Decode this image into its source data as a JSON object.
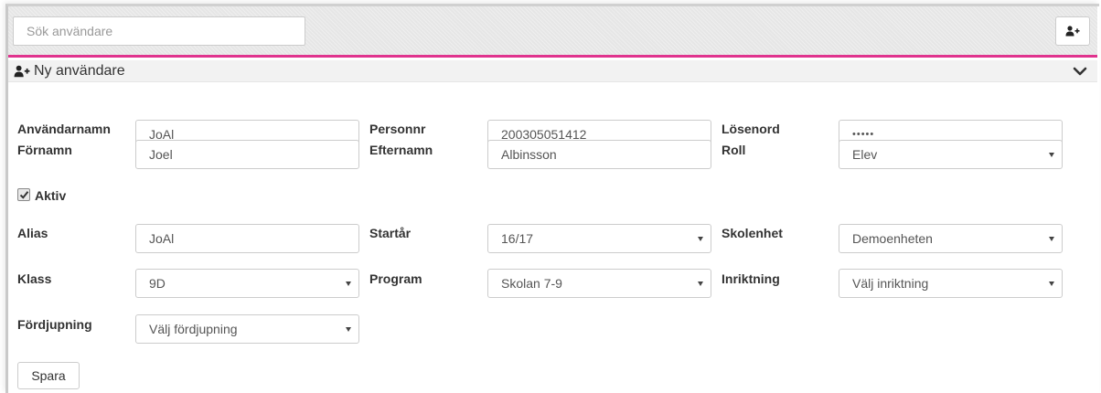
{
  "search": {
    "placeholder": "Sök användare"
  },
  "panel": {
    "title": "Ny användare"
  },
  "fields": {
    "username": {
      "label": "Användarnamn",
      "value": "JoAl"
    },
    "personnr": {
      "label": "Personnr",
      "value": "200305051412"
    },
    "password": {
      "label": "Lösenord",
      "value": "•••••"
    },
    "firstname": {
      "label": "Förnamn",
      "value": "Joel"
    },
    "lastname": {
      "label": "Efternamn",
      "value": "Albinsson"
    },
    "role": {
      "label": "Roll",
      "value": "Elev"
    },
    "active": {
      "label": "Aktiv",
      "checked": true
    },
    "alias": {
      "label": "Alias",
      "value": "JoAl"
    },
    "startyear": {
      "label": "Startår",
      "value": "16/17"
    },
    "schoolunit": {
      "label": "Skolenhet",
      "value": "Demoenheten"
    },
    "class": {
      "label": "Klass",
      "value": "9D"
    },
    "program": {
      "label": "Program",
      "value": "Skolan 7-9"
    },
    "orientation": {
      "label": "Inriktning",
      "value": "Välj inriktning"
    },
    "specialization": {
      "label": "Fördjupning",
      "value": "Välj fördjupning"
    }
  },
  "actions": {
    "save_label": "Spara"
  },
  "colors": {
    "accent": "#e0338e"
  },
  "icons": {
    "add_user": "user-plus-icon",
    "chevron": "chevron-down-icon",
    "checkbox": "checkmark-icon"
  }
}
